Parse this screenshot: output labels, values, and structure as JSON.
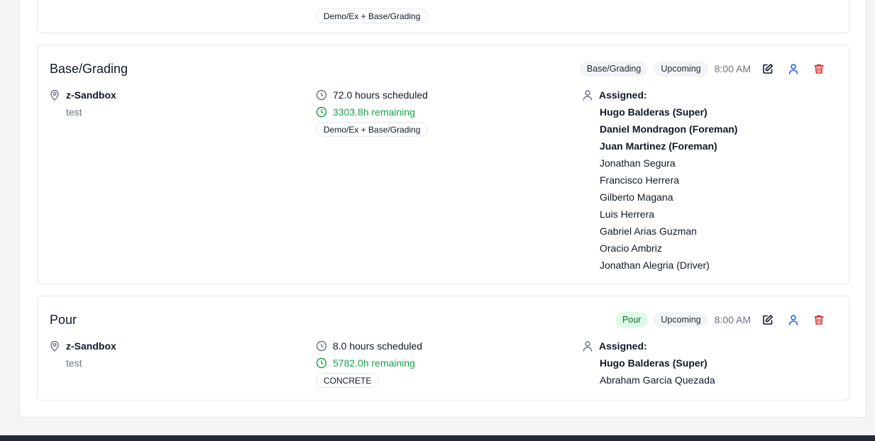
{
  "cards": [
    {
      "tag": "Demo/Ex + Base/Grading"
    },
    {
      "title": "Base/Grading",
      "category": "Base/Grading",
      "status": "Upcoming",
      "time": "8:00 AM",
      "location": "z-Sandbox",
      "sublocation": "test",
      "hours": "72.0 hours scheduled",
      "remaining": "3303.8h remaining",
      "tag": "Demo/Ex + Base/Grading",
      "assigned_label": "Assigned:",
      "people": [
        {
          "name": "Hugo Balderas (Super)",
          "bold": true
        },
        {
          "name": "Daniel Mondragon (Foreman)",
          "bold": true
        },
        {
          "name": "Juan Martinez (Foreman)",
          "bold": true
        },
        {
          "name": "Jonathan Segura",
          "bold": false
        },
        {
          "name": "Francisco Herrera",
          "bold": false
        },
        {
          "name": "Gilberto Magana",
          "bold": false
        },
        {
          "name": "Luis Herrera",
          "bold": false
        },
        {
          "name": "Gabriel Arias Guzman",
          "bold": false
        },
        {
          "name": "Oracio Ambriz",
          "bold": false
        },
        {
          "name": "Jonathan Alegria (Driver)",
          "bold": false
        }
      ]
    },
    {
      "title": "Pour",
      "category": "Pour",
      "status": "Upcoming",
      "time": "8:00 AM",
      "location": "z-Sandbox",
      "sublocation": "test",
      "hours": "8.0 hours scheduled",
      "remaining": "5782.0h remaining",
      "tag": "CONCRETE",
      "assigned_label": "Assigned:",
      "people": [
        {
          "name": "Hugo Balderas (Super)",
          "bold": true
        },
        {
          "name": "Abraham Garcia Quezada",
          "bold": false
        }
      ]
    }
  ],
  "icons": {
    "location": "map-pin-icon",
    "clock": "clock-icon",
    "person": "user-icon",
    "edit": "edit-icon",
    "assign": "user-assign-icon",
    "delete": "trash-icon"
  },
  "colors": {
    "remaining": "#16a34a",
    "delete": "#dc2626",
    "assign": "#2563eb",
    "pour_pill": "#dcfce7"
  }
}
